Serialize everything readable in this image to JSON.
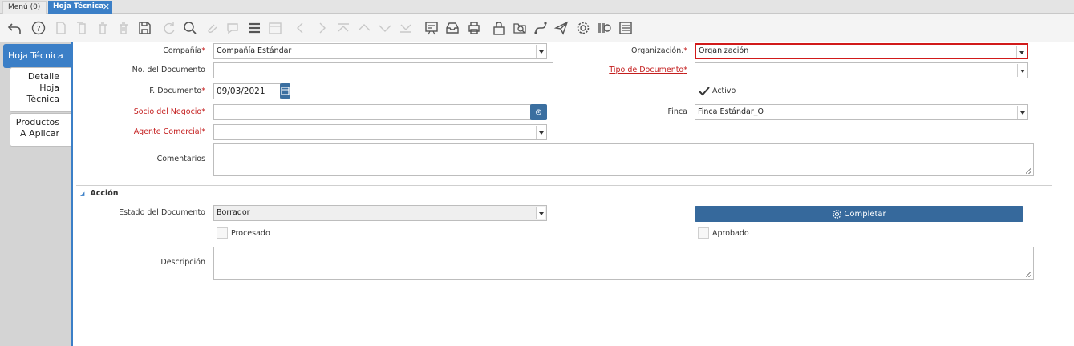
{
  "tabs": {
    "menu_label": "Menú (0)",
    "active_label": "Hoja Técnica"
  },
  "toolbar": {
    "icons": [
      "undo-icon",
      "help-icon",
      "new-icon",
      "copy-icon",
      "delete-icon",
      "delete-multiple-icon",
      "save-icon",
      "refresh-icon",
      "search-icon",
      "attachment-icon",
      "chat-icon",
      "grid-toggle-icon",
      "calendar-icon",
      "previous-icon",
      "next-icon",
      "first-icon",
      "up-icon",
      "down-icon",
      "last-icon",
      "report-icon",
      "archive-icon",
      "print-icon",
      "lock-icon",
      "zoom-across-icon",
      "workflow-icon",
      "send-icon",
      "process-icon",
      "product-info-icon",
      "form-icon"
    ]
  },
  "left_tabs": {
    "active": "Hoja Técnica",
    "tab1": "Detalle Hoja Técnica",
    "tab2": "Productos A Aplicar"
  },
  "form": {
    "compania_label": "Compañía",
    "compania_value": "Compañía Estándar",
    "organizacion_label": "Organización.",
    "organizacion_value": "Organización",
    "no_documento_label": "No. del Documento",
    "no_documento_value": "",
    "tipo_documento_label": "Tipo de Documento",
    "tipo_documento_value": "",
    "f_documento_label": "F. Documento",
    "f_documento_value": "09/03/2021",
    "activo_label": "Activo",
    "activo_checked": true,
    "socio_label": "Socio del Negocio",
    "socio_value": "",
    "finca_label": "Finca",
    "finca_value": "Finca Estándar_O",
    "agente_label": "Agente Comercial",
    "agente_value": "",
    "comentarios_label": "Comentarios",
    "comentarios_value": "",
    "required_mark": "*"
  },
  "accion": {
    "section_label": "Acción",
    "estado_label": "Estado del Documento",
    "estado_value": "Borrador",
    "completar_label": "Completar",
    "procesado_label": "Procesado",
    "aprobado_label": "Aprobado",
    "descripcion_label": "Descripción",
    "descripcion_value": ""
  },
  "colors": {
    "accent": "#3b7fc7",
    "button": "#36699c",
    "error_border": "#d11a1a",
    "required": "#c41e1e"
  }
}
